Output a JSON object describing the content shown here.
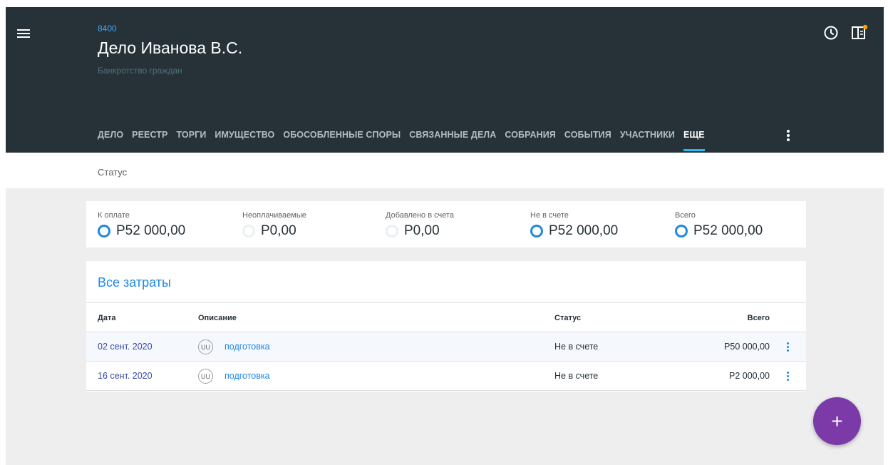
{
  "case": {
    "number": "8400",
    "title": "Дело Иванова В.С.",
    "subtitle": "Банкротство граждан"
  },
  "header_icons": [
    "menu-icon",
    "clock-icon",
    "panel-notification-icon"
  ],
  "tabs": [
    {
      "label": "ДЕЛО",
      "active": false
    },
    {
      "label": "РЕЕСТР",
      "active": false
    },
    {
      "label": "ТОРГИ",
      "active": false
    },
    {
      "label": "ИМУЩЕСТВО",
      "active": false
    },
    {
      "label": "ОБОСОБЛЕННЫЕ СПОРЫ",
      "active": false
    },
    {
      "label": "СВЯЗАННЫЕ ДЕЛА",
      "active": false
    },
    {
      "label": "СОБРАНИЯ",
      "active": false
    },
    {
      "label": "СОБЫТИЯ",
      "active": false
    },
    {
      "label": "УЧАСТНИКИ",
      "active": false
    },
    {
      "label": "ЕЩЕ",
      "active": true
    }
  ],
  "statusbar": {
    "label": "Статус"
  },
  "summary": [
    {
      "label": "К оплате",
      "value": "Р52 000,00",
      "ring": "active"
    },
    {
      "label": "Неоплачиваемые",
      "value": "Р0,00",
      "ring": "faint"
    },
    {
      "label": "Добавлено в счета",
      "value": "Р0,00",
      "ring": "faint"
    },
    {
      "label": "Не в счете",
      "value": "Р52 000,00",
      "ring": "active"
    },
    {
      "label": "Всего",
      "value": "Р52 000,00",
      "ring": "active"
    }
  ],
  "costs": {
    "title": "Все затраты",
    "columns": {
      "date": "Дата",
      "description": "Описание",
      "status": "Статус",
      "total": "Всего"
    },
    "rows": [
      {
        "date": "02 сент. 2020",
        "badge": "UU",
        "description": "подготовка",
        "status": "Не в счете",
        "total": "Р50 000,00"
      },
      {
        "date": "16 сент. 2020",
        "badge": "UU",
        "description": "подготовка",
        "status": "Не в счете",
        "total": "Р2 000,00"
      }
    ]
  },
  "fab": {
    "label": "+"
  },
  "colors": {
    "header_bg": "#263238",
    "accent_blue": "#1e88e5",
    "tab_indicator": "#29b6f6",
    "fab": "#7b3aa8",
    "notification_dot": "#ffa000"
  }
}
